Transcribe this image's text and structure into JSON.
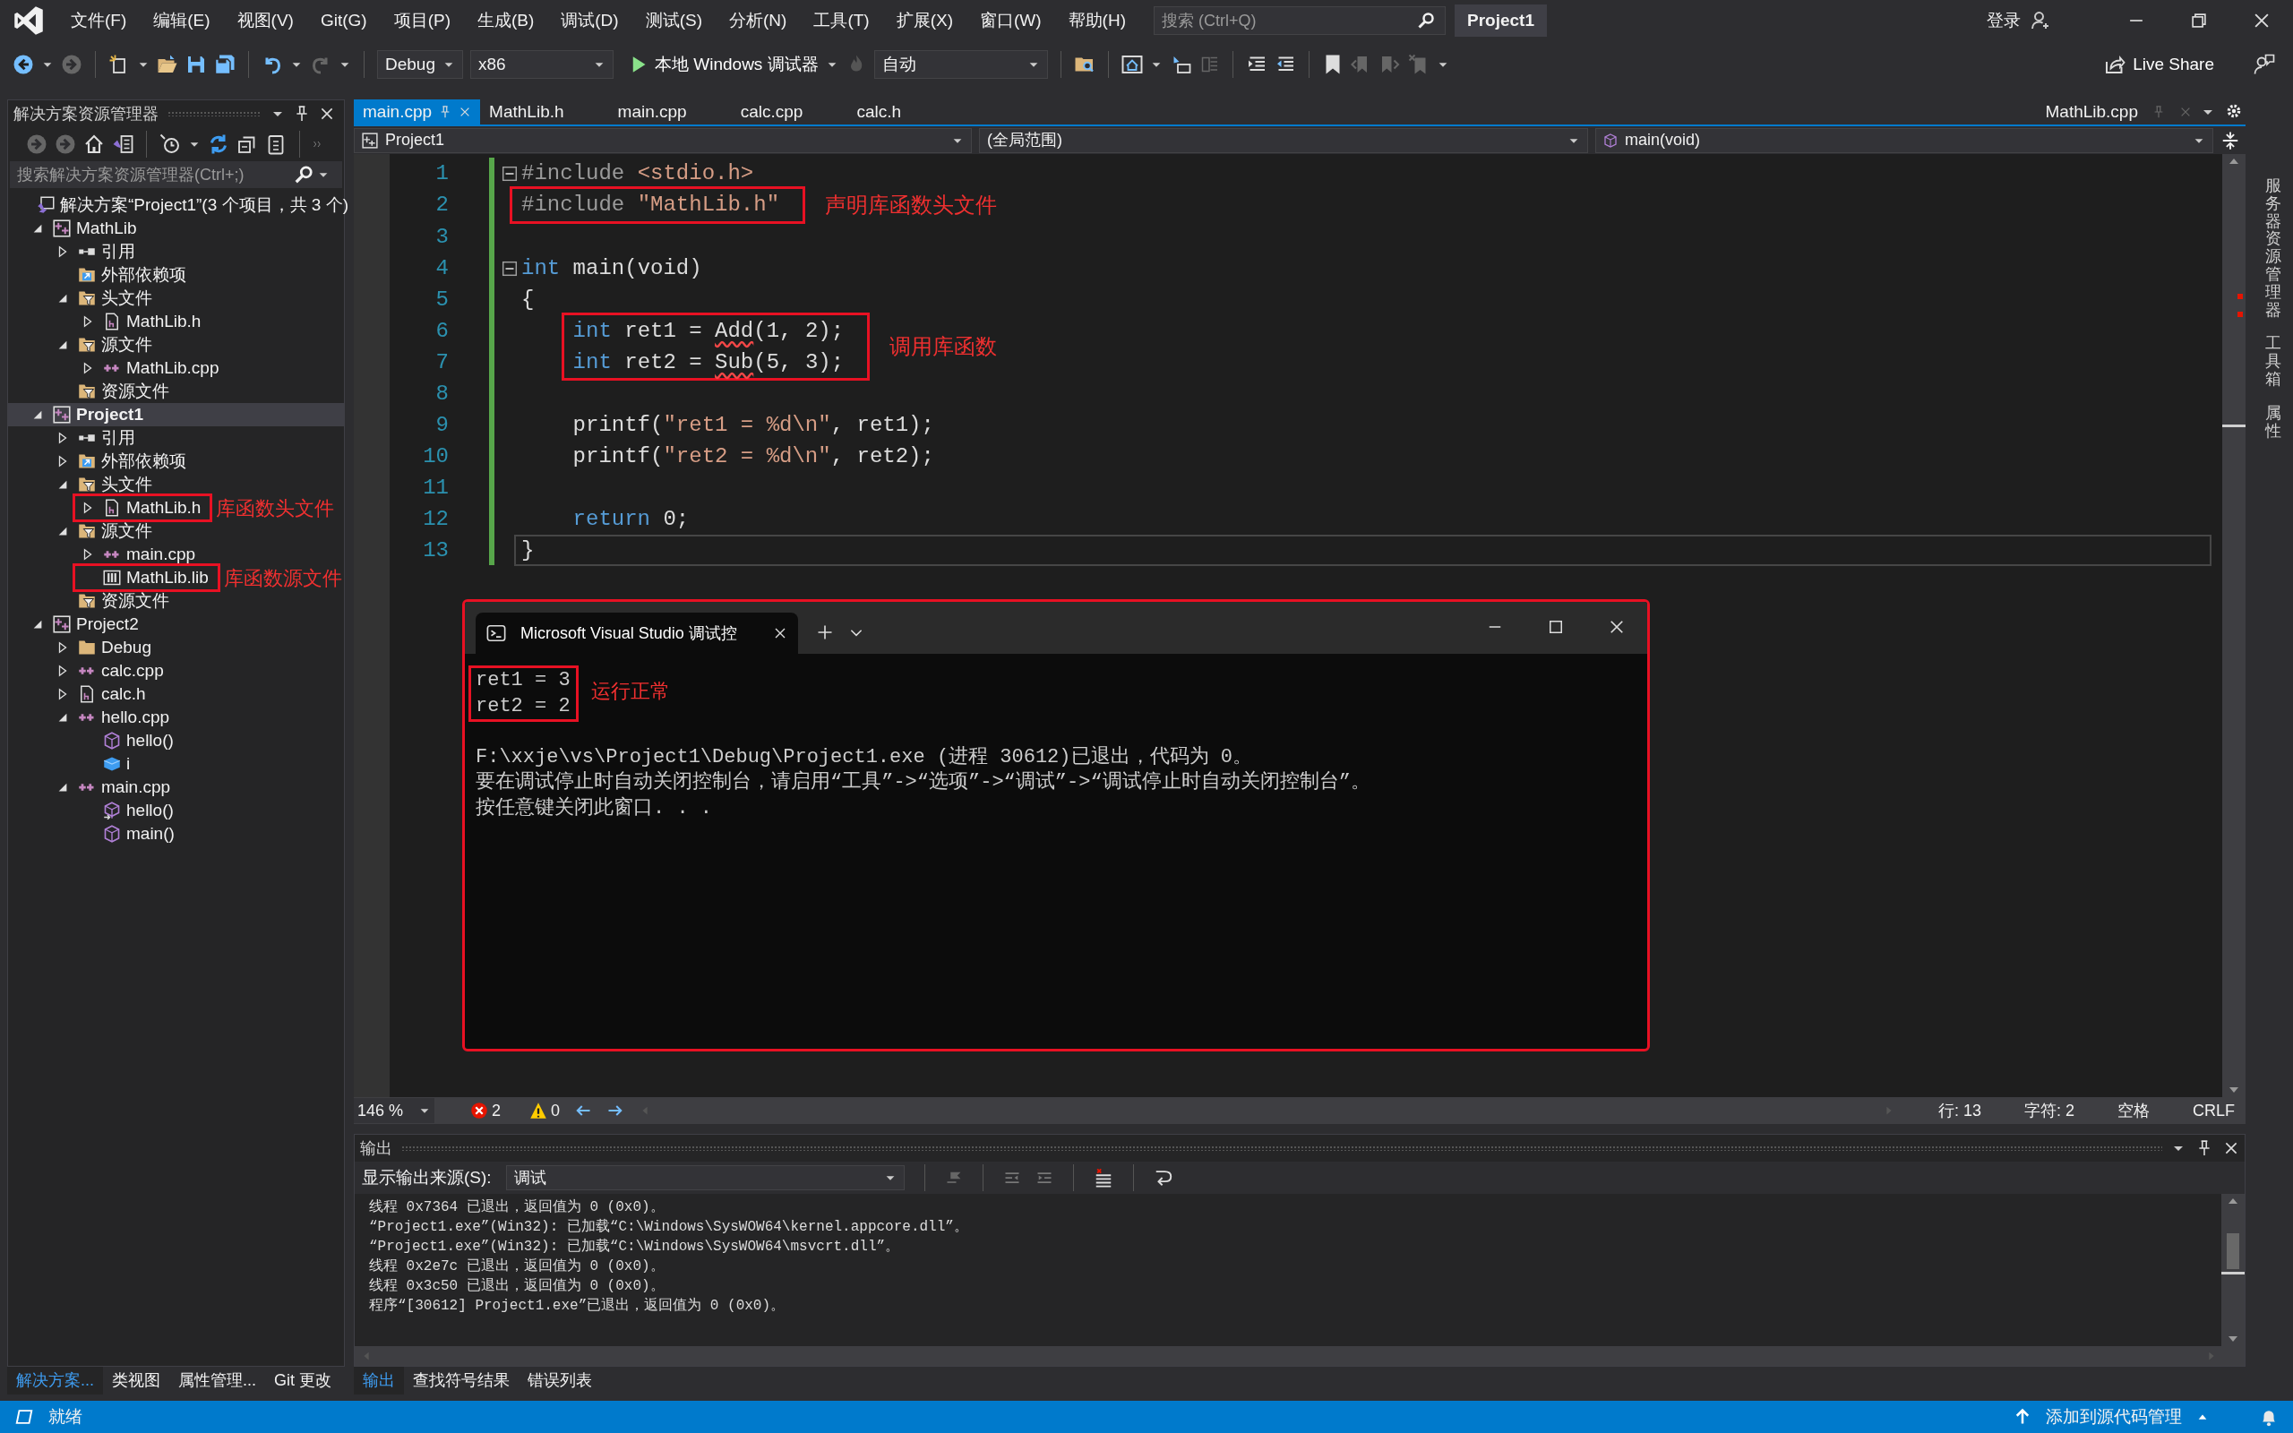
{
  "title_bar": {
    "menu": [
      "文件(F)",
      "编辑(E)",
      "视图(V)",
      "Git(G)",
      "项目(P)",
      "生成(B)",
      "调试(D)",
      "测试(S)",
      "分析(N)",
      "工具(T)",
      "扩展(X)",
      "窗口(W)",
      "帮助(H)"
    ],
    "search": {
      "placeholder": "搜索 (Ctrl+Q)"
    },
    "solution_name": "Project1",
    "sign_in": "登录"
  },
  "toolbar": {
    "configuration": "Debug",
    "platform": "x86",
    "debugger": "本地 Windows 调试器",
    "stack_frame": "自动",
    "live_share": "Live Share"
  },
  "solution_explorer": {
    "title": "解决方案资源管理器",
    "search": {
      "placeholder": "搜索解决方案资源管理器(Ctrl+;)"
    },
    "tree": [
      {
        "label": "解决方案“Project1”(3 个项目，共 3 个)",
        "kind": "solution",
        "selected": false,
        "children": [
          {
            "label": "MathLib",
            "kind": "project",
            "expanded": true,
            "selected": false,
            "children": [
              {
                "label": "引用",
                "kind": "references",
                "expanded": false,
                "selected": false
              },
              {
                "label": "外部依赖项",
                "kind": "external",
                "selected": false
              },
              {
                "label": "头文件",
                "kind": "filter",
                "expanded": true,
                "selected": false,
                "children": [
                  {
                    "label": "MathLib.h",
                    "kind": "header",
                    "expanded": false,
                    "selected": false
                  }
                ]
              },
              {
                "label": "源文件",
                "kind": "filter",
                "expanded": true,
                "selected": false,
                "children": [
                  {
                    "label": "MathLib.cpp",
                    "kind": "cpp",
                    "expanded": false,
                    "selected": false
                  }
                ]
              },
              {
                "label": "资源文件",
                "kind": "filter",
                "selected": false
              }
            ]
          },
          {
            "label": "Project1",
            "kind": "project",
            "expanded": true,
            "selected": true,
            "children": [
              {
                "label": "引用",
                "kind": "references",
                "expanded": false,
                "selected": false
              },
              {
                "label": "外部依赖项",
                "kind": "external",
                "expanded": false,
                "selected": false
              },
              {
                "label": "头文件",
                "kind": "filter",
                "expanded": true,
                "selected": false,
                "children": [
                  {
                    "label": "MathLib.h",
                    "kind": "header",
                    "expanded": false,
                    "selected": false,
                    "callout": "库函数头文件"
                  }
                ]
              },
              {
                "label": "源文件",
                "kind": "filter",
                "expanded": true,
                "selected": false,
                "children": [
                  {
                    "label": "main.cpp",
                    "kind": "cpp",
                    "expanded": false,
                    "selected": false
                  },
                  {
                    "label": "MathLib.lib",
                    "kind": "lib",
                    "selected": false,
                    "callout": "库函数源文件"
                  }
                ]
              },
              {
                "label": "资源文件",
                "kind": "filter",
                "selected": false
              }
            ]
          },
          {
            "label": "Project2",
            "kind": "project",
            "expanded": true,
            "selected": false,
            "children": [
              {
                "label": "Debug",
                "kind": "folder",
                "expanded": false,
                "selected": false
              },
              {
                "label": "calc.cpp",
                "kind": "cpp",
                "expanded": false,
                "selected": false
              },
              {
                "label": "calc.h",
                "kind": "header",
                "expanded": false,
                "selected": false
              },
              {
                "label": "hello.cpp",
                "kind": "cpp",
                "expanded": true,
                "selected": false,
                "children": [
                  {
                    "label": "hello()",
                    "kind": "method",
                    "selected": false
                  },
                  {
                    "label": "i",
                    "kind": "field",
                    "selected": false
                  }
                ]
              },
              {
                "label": "main.cpp",
                "kind": "cpp",
                "expanded": true,
                "selected": false,
                "children": [
                  {
                    "label": "hello()",
                    "kind": "method_ref",
                    "selected": false
                  },
                  {
                    "label": "main()",
                    "kind": "method",
                    "selected": false
                  }
                ]
              }
            ]
          }
        ]
      }
    ],
    "tabs": [
      {
        "label": "解决方案...",
        "selected": true
      },
      {
        "label": "类视图",
        "selected": false
      },
      {
        "label": "属性管理...",
        "selected": false
      },
      {
        "label": "Git 更改",
        "selected": false
      }
    ]
  },
  "editor": {
    "tabs": [
      {
        "label": "main.cpp",
        "selected": true
      },
      {
        "label": "MathLib.h",
        "selected": false
      },
      {
        "label": "main.cpp",
        "selected": false
      },
      {
        "label": "calc.cpp",
        "selected": false
      },
      {
        "label": "calc.h",
        "selected": false
      }
    ],
    "preview_tab": {
      "label": "MathLib.cpp"
    },
    "nav": {
      "project": "Project1",
      "scope": "(全局范围)",
      "member": "main(void)"
    },
    "blocks": [
      {
        "lines": [
          {
            "number": "1",
            "folded": false,
            "current": false,
            "tokens": [
              {
                "text": "#include ",
                "kind": "directive"
              },
              {
                "text": "<stdio.h>",
                "kind": "string"
              }
            ]
          }
        ]
      },
      {
        "callout": "声明库函数头文件",
        "lines": [
          {
            "number": "2",
            "current": false,
            "tokens": [
              {
                "text": "#include ",
                "kind": "directive"
              },
              {
                "text": "\"MathLib.h\"",
                "kind": "string"
              }
            ]
          }
        ]
      },
      {
        "lines": [
          {
            "number": "3",
            "current": false
          },
          {
            "number": "4",
            "folded": false,
            "current": false,
            "tokens": [
              {
                "text": "int",
                "kind": "keyword"
              },
              {
                "text": " main(void)",
                "kind": "plain"
              }
            ]
          },
          {
            "number": "5",
            "current": false,
            "tokens": [
              {
                "text": "{",
                "kind": "plain"
              }
            ]
          }
        ]
      },
      {
        "callout": "调用库函数",
        "lines": [
          {
            "number": "6",
            "current": false,
            "tokens": [
              {
                "text": "    int",
                "kind": "keyword"
              },
              {
                "text": " ret1 = ",
                "kind": "plain"
              },
              {
                "text": "Add",
                "kind": "error"
              },
              {
                "text": "(1, 2);",
                "kind": "plain"
              }
            ]
          },
          {
            "number": "7",
            "current": false,
            "tokens": [
              {
                "text": "    int",
                "kind": "keyword"
              },
              {
                "text": " ret2 = ",
                "kind": "plain"
              },
              {
                "text": "Sub",
                "kind": "error"
              },
              {
                "text": "(5, 3);",
                "kind": "plain"
              }
            ]
          }
        ]
      },
      {
        "lines": [
          {
            "number": "8",
            "current": false
          },
          {
            "number": "9",
            "current": false,
            "tokens": [
              {
                "text": "    printf(",
                "kind": "plain"
              },
              {
                "text": "\"ret1 = %d\\n\"",
                "kind": "string"
              },
              {
                "text": ", ret1);",
                "kind": "plain"
              }
            ]
          },
          {
            "number": "10",
            "current": false,
            "tokens": [
              {
                "text": "    printf(",
                "kind": "plain"
              },
              {
                "text": "\"ret2 = %d\\n\"",
                "kind": "string"
              },
              {
                "text": ", ret2);",
                "kind": "plain"
              }
            ]
          },
          {
            "number": "11",
            "current": false
          },
          {
            "number": "12",
            "current": false,
            "tokens": [
              {
                "text": "    return",
                "kind": "keyword"
              },
              {
                "text": " 0;",
                "kind": "plain"
              }
            ]
          },
          {
            "number": "13",
            "current": true,
            "tokens": [
              {
                "text": "}",
                "kind": "plain"
              }
            ]
          }
        ]
      }
    ],
    "status": {
      "zoom": "146 %",
      "errors": "2",
      "warnings": "0",
      "line": "行: 13",
      "column": "字符: 2",
      "whitespace": "空格",
      "line_ending": "CRLF"
    }
  },
  "console": {
    "title": "Microsoft Visual Studio 调试控",
    "blocks": [
      {
        "callout": "运行正常",
        "lines": [
          "ret1 = 3",
          "ret2 = 2"
        ]
      },
      {
        "lines": [
          "F:\\xxje\\vs\\Project1\\Debug\\Project1.exe (进程 30612)已退出，代码为 0。",
          "要在调试停止时自动关闭控制台，请启用“工具”->“选项”->“调试”->“调试停止时自动关闭控制台”。",
          "按任意键关闭此窗口. . ."
        ]
      }
    ]
  },
  "output": {
    "title": "输出",
    "source_label": "显示输出来源(S):",
    "source": "调试",
    "lines": [
      "线程 0x7364 已退出，返回值为 0 (0x0)。",
      "“Project1.exe”(Win32): 已加载“C:\\Windows\\SysWOW64\\kernel.appcore.dll”。",
      "“Project1.exe”(Win32): 已加载“C:\\Windows\\SysWOW64\\msvcrt.dll”。",
      "线程 0x2e7c 已退出，返回值为 0 (0x0)。",
      "线程 0x3c50 已退出，返回值为 0 (0x0)。",
      "程序“[30612] Project1.exe”已退出，返回值为 0 (0x0)。"
    ],
    "tabs": [
      {
        "label": "输出",
        "selected": true
      },
      {
        "label": "查找符号结果",
        "selected": false
      },
      {
        "label": "错误列表",
        "selected": false
      }
    ]
  },
  "side_strip": [
    "服务器资源管理器",
    "工具箱",
    "属性"
  ],
  "status_bar": {
    "message": "就绪",
    "source_control": "添加到源代码管理"
  }
}
